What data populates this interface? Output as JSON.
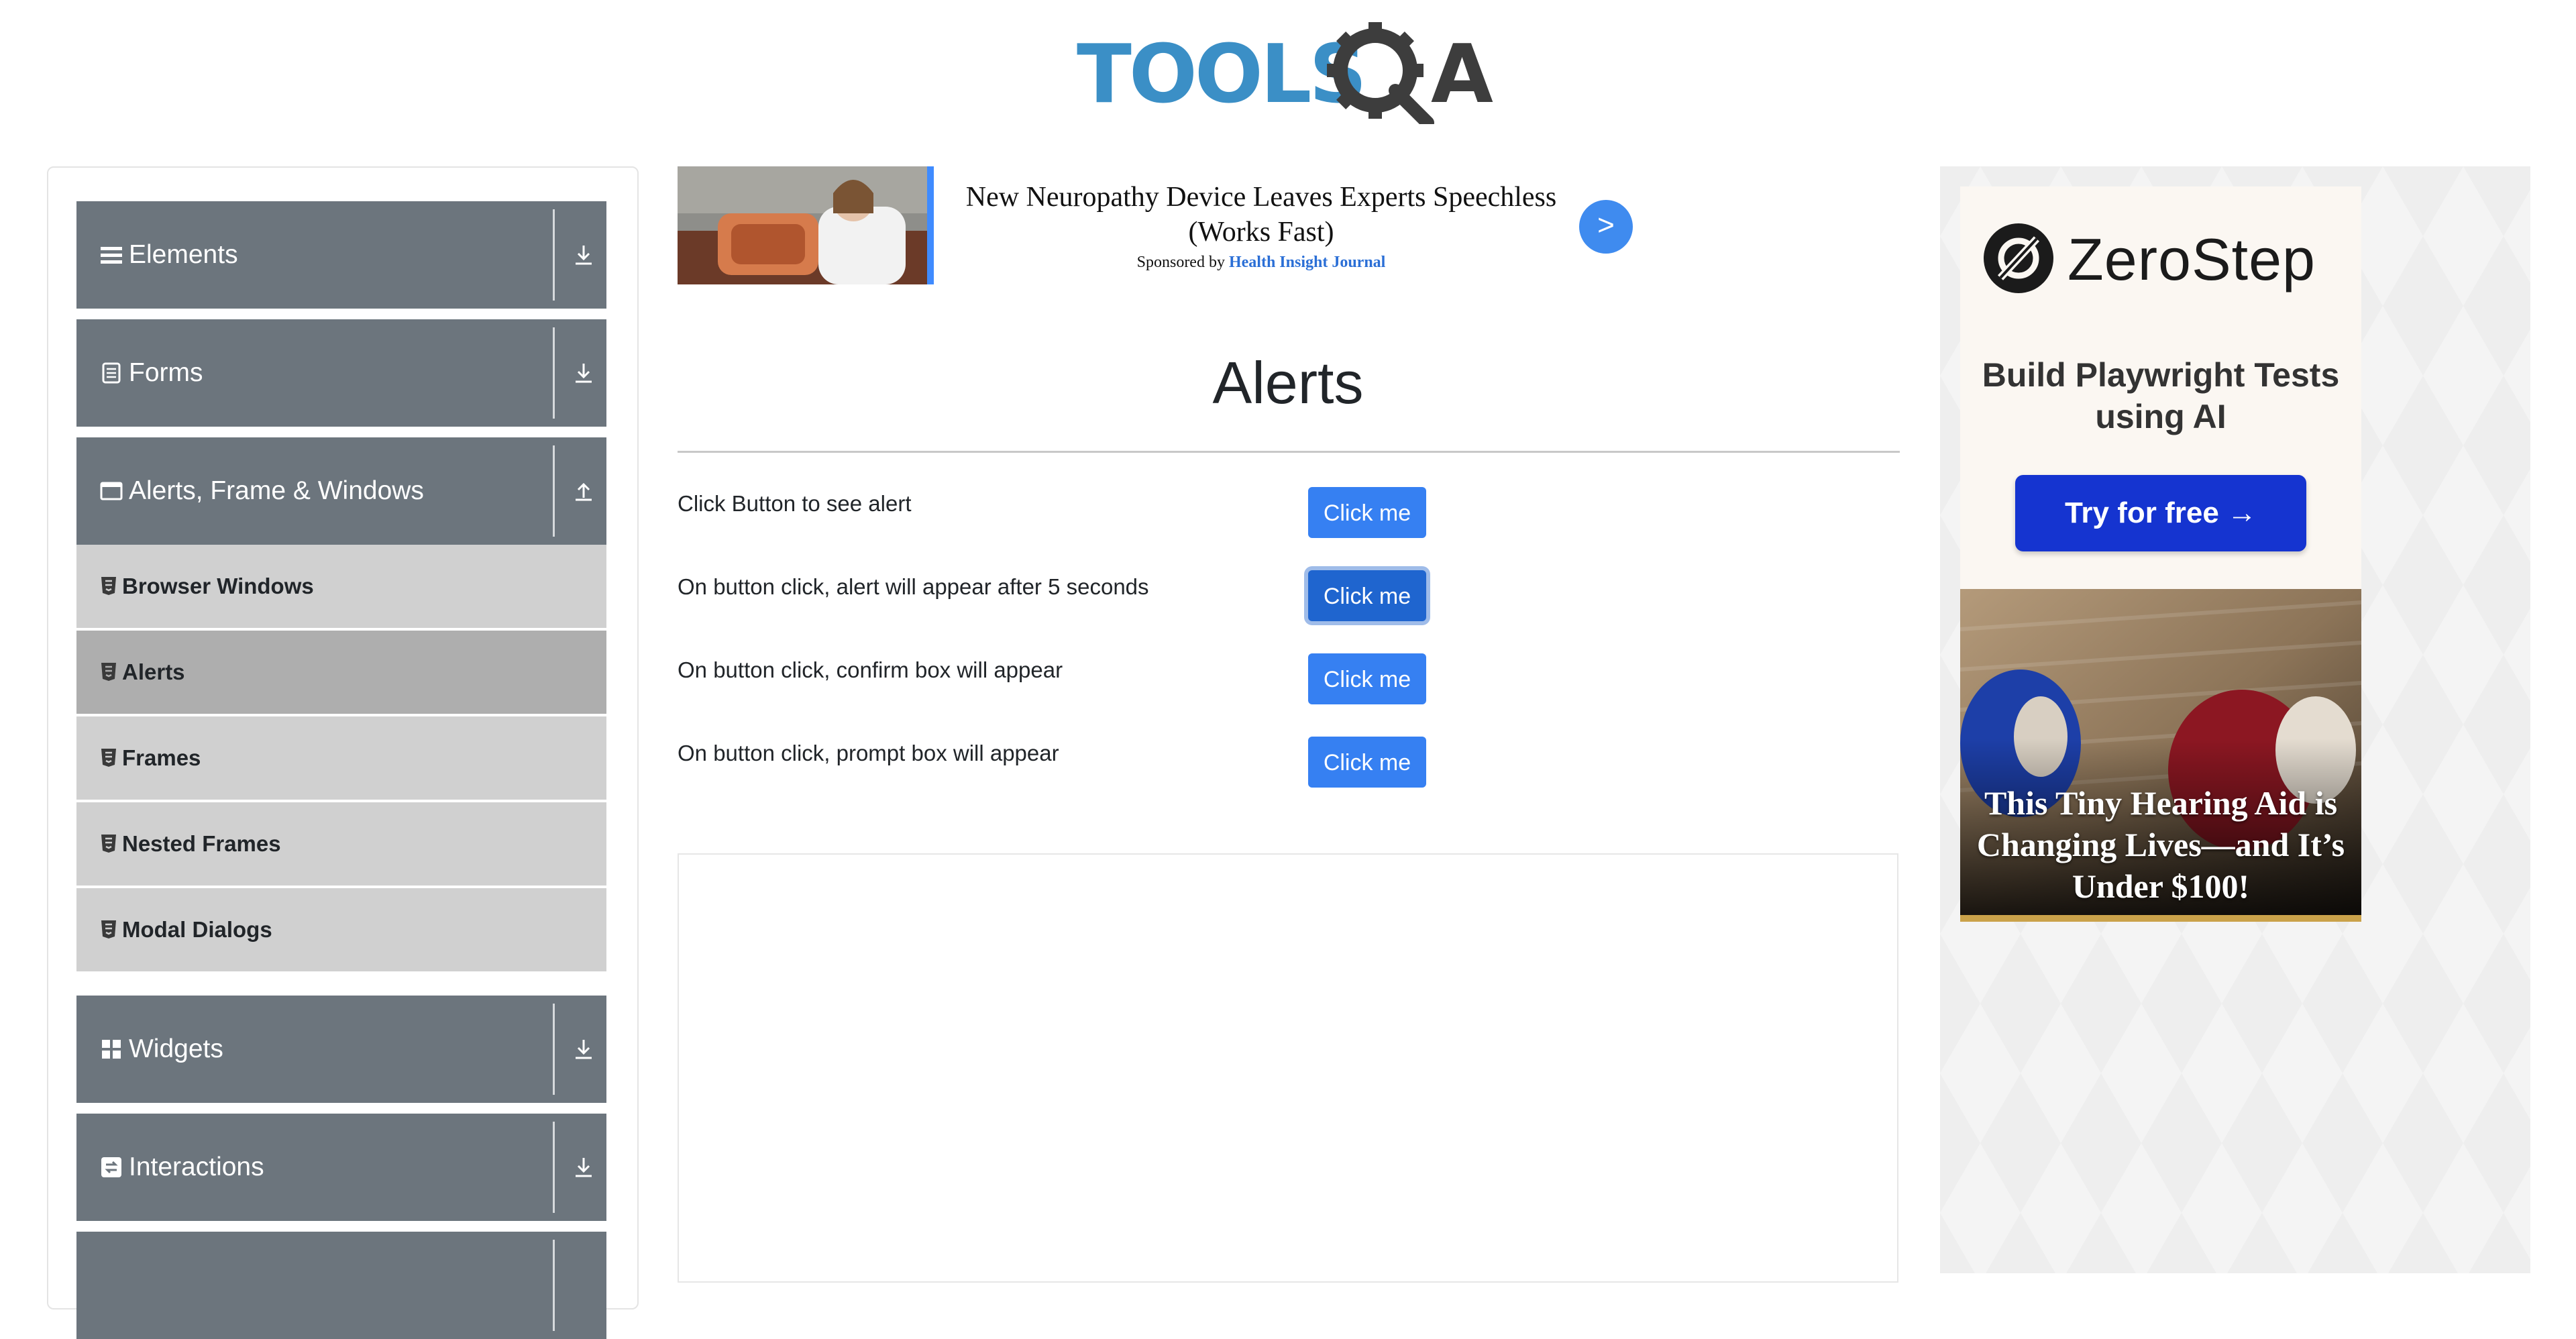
{
  "header": {
    "logo_text": "TOOLSQA"
  },
  "sidebar": {
    "groups": [
      {
        "label": "Elements",
        "icon": "hamburger-icon",
        "expanded": false
      },
      {
        "label": "Forms",
        "icon": "document-icon",
        "expanded": false
      },
      {
        "label": "Alerts, Frame & Windows",
        "icon": "window-icon",
        "expanded": true
      },
      {
        "label": "Widgets",
        "icon": "grid-icon",
        "expanded": false
      },
      {
        "label": "Interactions",
        "icon": "interaction-icon",
        "expanded": false
      }
    ],
    "subitems": [
      {
        "label": "Browser Windows",
        "active": false
      },
      {
        "label": "Alerts",
        "active": true
      },
      {
        "label": "Frames",
        "active": false
      },
      {
        "label": "Nested Frames",
        "active": false
      },
      {
        "label": "Modal Dialogs",
        "active": false
      }
    ]
  },
  "banner_ad": {
    "headline": "New Neuropathy Device Leaves Experts Speechless (Works Fast)",
    "sponsored_prefix": "Sponsored by",
    "sponsor": "Health Insight Journal",
    "go_label": ">"
  },
  "main": {
    "title": "Alerts",
    "rows": [
      {
        "label": "Click Button to see alert",
        "button": "Click me"
      },
      {
        "label": "On button click, alert will appear after 5 seconds",
        "button": "Click me"
      },
      {
        "label": "On button click, confirm box will appear",
        "button": "Click me"
      },
      {
        "label": "On button click, prompt box will appear",
        "button": "Click me"
      }
    ]
  },
  "right_ad": {
    "brand": "ZeroStep",
    "tagline": "Build Playwright Tests using AI",
    "cta": "Try for free →",
    "hearing_headline": "This Tiny Hearing Aid is Changing Lives—and It’s Under $100!"
  },
  "colors": {
    "sidebar_header": "#6c757d",
    "sidebar_item": "#d0d0d0",
    "sidebar_item_active": "#aeaeae",
    "button": "#3680f2",
    "cta": "#1534d0"
  }
}
